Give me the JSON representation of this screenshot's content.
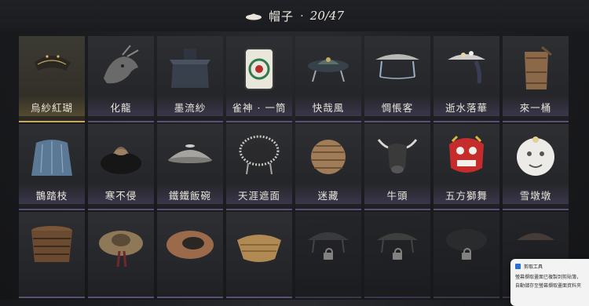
{
  "header": {
    "icon": "hat-icon",
    "title": "帽子",
    "separator": "·",
    "count": "20/47"
  },
  "items": [
    {
      "name": "烏紗紅瑚",
      "icon": "gauze-hat-icon",
      "selected": true
    },
    {
      "name": "化龍",
      "icon": "dragon-head-icon"
    },
    {
      "name": "墨流紗",
      "icon": "veil-hat-icon"
    },
    {
      "name": "雀神 · 一筒",
      "icon": "mahjong-tile-icon"
    },
    {
      "name": "快哉風",
      "icon": "ornate-hat-icon"
    },
    {
      "name": "惆悵客",
      "icon": "bamboo-hat-icon"
    },
    {
      "name": "逝水落華",
      "icon": "flower-hat-icon"
    },
    {
      "name": "來一桶",
      "icon": "bucket-hat-icon"
    },
    {
      "name": "鵲踏枝",
      "icon": "blue-hood-icon"
    },
    {
      "name": "寒不侵",
      "icon": "fur-hat-icon"
    },
    {
      "name": "鐵鐵飯碗",
      "icon": "iron-bowl-icon"
    },
    {
      "name": "天涯遮面",
      "icon": "woven-cage-icon"
    },
    {
      "name": "迷藏",
      "icon": "wicker-ball-icon"
    },
    {
      "name": "牛頭",
      "icon": "bull-head-icon"
    },
    {
      "name": "五方獅舞",
      "icon": "lion-dance-icon"
    },
    {
      "name": "雪墩墩",
      "icon": "snow-lion-icon"
    },
    {
      "name": "",
      "icon": "stacked-basket-icon"
    },
    {
      "name": "",
      "icon": "straw-hat-icon"
    },
    {
      "name": "",
      "icon": "conical-hat-icon"
    },
    {
      "name": "",
      "icon": "woven-basket-icon"
    },
    {
      "name": "",
      "icon": "locked-hat-icon",
      "locked": true
    },
    {
      "name": "",
      "icon": "locked-hat-icon",
      "locked": true
    },
    {
      "name": "",
      "icon": "locked-hat-icon",
      "locked": true
    },
    {
      "name": "",
      "icon": "locked-hat-icon",
      "locked": true
    }
  ],
  "toast": {
    "app": "剪取工具",
    "line1": "螢幕擷取畫面已複製到剪貼簿，",
    "line2": "自動儲存至螢幕擷取畫面資料夾"
  }
}
